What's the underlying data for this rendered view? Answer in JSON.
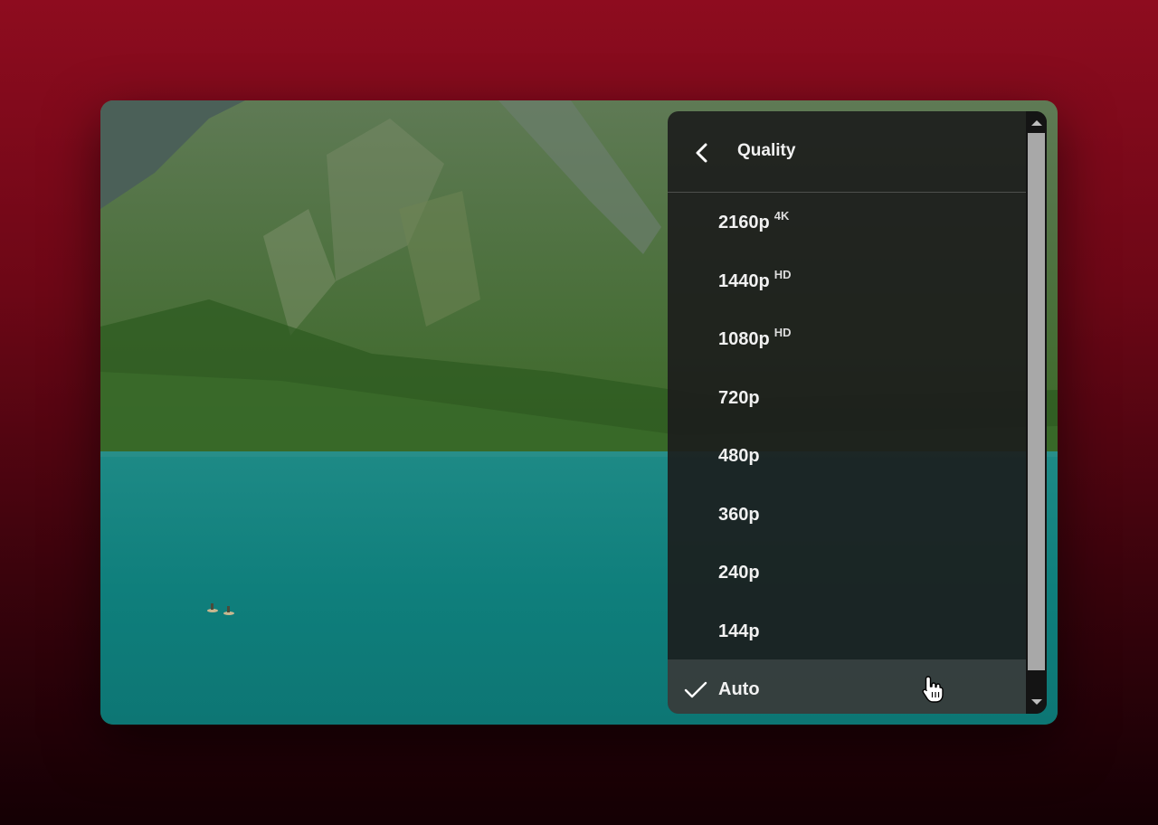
{
  "colors": {
    "background_top": "#8e0c1f",
    "background_bottom": "#140004",
    "menu_bg": "rgba(28,28,28,0.9)",
    "text": "#f1f1f1",
    "scroll_thumb": "#a8a8a8"
  },
  "video": {
    "scene": "mountain-lake-icon"
  },
  "quality_menu": {
    "back_icon": "chevron-left-icon",
    "title": "Quality",
    "options": [
      {
        "label": "2160p",
        "badge": "4K"
      },
      {
        "label": "1440p",
        "badge": "HD"
      },
      {
        "label": "1080p",
        "badge": "HD"
      },
      {
        "label": "720p",
        "badge": ""
      },
      {
        "label": "480p",
        "badge": ""
      },
      {
        "label": "360p",
        "badge": ""
      },
      {
        "label": "240p",
        "badge": ""
      },
      {
        "label": "144p",
        "badge": ""
      },
      {
        "label": "Auto",
        "badge": "",
        "selected": true
      }
    ],
    "selected_icon": "checkmark-icon"
  },
  "cursor": "hand-pointer-icon"
}
